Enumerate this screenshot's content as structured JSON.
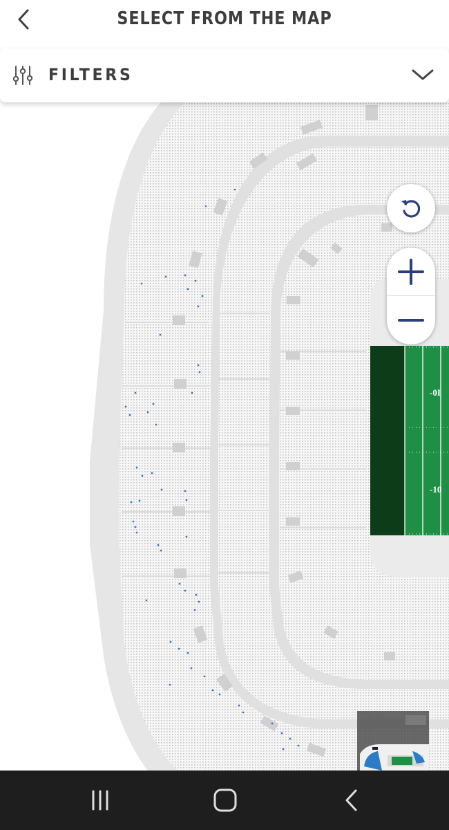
{
  "header": {
    "title": "SELECT FROM THE MAP",
    "back_icon": "chevron-left-icon"
  },
  "filters": {
    "label": "FILTERS",
    "icon": "sliders-icon",
    "toggle_icon": "chevron-down-icon"
  },
  "map": {
    "field_yard_lines": [
      "-0I",
      "-10"
    ],
    "colors": {
      "field_green": "#1e8f45",
      "endzone_green": "#0d3d18",
      "available_seat": "#2a7cc7",
      "seat_section": "#f4f4f4",
      "concourse": "#e0e0e0"
    }
  },
  "controls": {
    "reset_icon": "rotate-ccw-icon",
    "zoom_in_icon": "plus-icon",
    "zoom_out_icon": "minus-icon"
  },
  "system_nav": {
    "recents_icon": "recents-icon",
    "home_icon": "home-icon",
    "back_icon": "back-icon"
  }
}
